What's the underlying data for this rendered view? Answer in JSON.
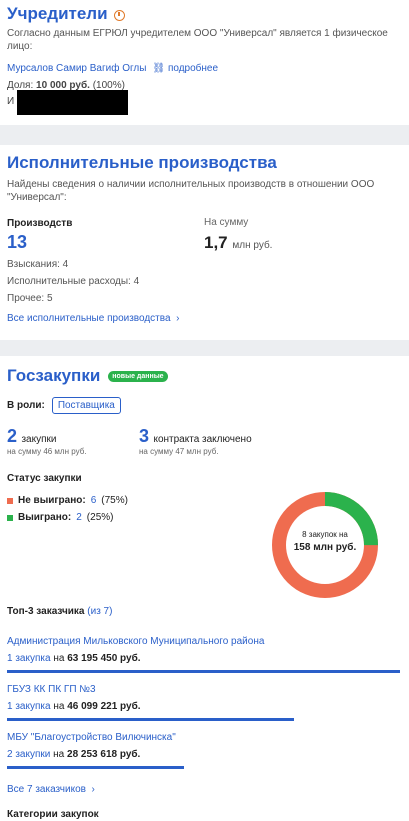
{
  "founders": {
    "title": "Учредители",
    "description": "Согласно данным ЕГРЮЛ учредителем ООО \"Универсал\" является 1 физическое лицо:",
    "person_name": "Мурсалов Самир Вагиф Оглы",
    "more_link": "подробнее",
    "share_label": "Доля:",
    "share_value": "10 000 руб.",
    "share_pct": "(100%)",
    "inn_prefix": "И"
  },
  "enforcement": {
    "title": "Исполнительные производства",
    "description": "Найдены сведения о наличии исполнительных производств в отношении ООО \"Универсал\":",
    "count_label": "Производств",
    "count_value": "13",
    "sum_label": "На сумму",
    "sum_value": "1,7",
    "sum_unit": "млн руб.",
    "line1": "Взыскания: 4",
    "line2": "Исполнительные расходы: 4",
    "line3": "Прочее: 5",
    "all_link": "Все исполнительные производства"
  },
  "procurement": {
    "title": "Госзакупки",
    "badge": "новые данные",
    "role_label": "В роли:",
    "role_value": "Поставщика",
    "stat1_num": "2",
    "stat1_text": "закупки",
    "stat1_sub": "на сумму 46 млн руб.",
    "stat2_num": "3",
    "stat2_text": "контракта заключено",
    "stat2_sub": "на сумму 47 млн руб.",
    "status_title": "Статус закупки",
    "lost_label": "Не выиграно:",
    "lost_count": "6",
    "lost_pct": "(75%)",
    "won_label": "Выиграно:",
    "won_count": "2",
    "won_pct": "(25%)",
    "lost_fraction": 0.75,
    "won_fraction": 0.25,
    "lost_color": "#ef6c4f",
    "won_color": "#2bb24c",
    "donut_line1": "8 закупок на",
    "donut_line2": "158 млн руб.",
    "top3_title": "Топ-3 заказчика",
    "top3_of": "(из 7)",
    "customers": [
      {
        "name": "Администрация Мильковского Муниципального района",
        "count": "1 закупка",
        "on": "на",
        "amount": "63 195 450 руб.",
        "share": 1.0
      },
      {
        "name": "ГБУЗ КК ПК ГП №3",
        "count": "1 закупка",
        "on": "на",
        "amount": "46 099 221 руб.",
        "share": 0.73
      },
      {
        "name": "МБУ \"Благоустройство Вилючинска\"",
        "count": "2 закупки",
        "on": "на",
        "amount": "28 253 618 руб.",
        "share": 0.45
      }
    ],
    "all_customers": "Все 7 заказчиков",
    "categories_title": "Категории закупок"
  }
}
